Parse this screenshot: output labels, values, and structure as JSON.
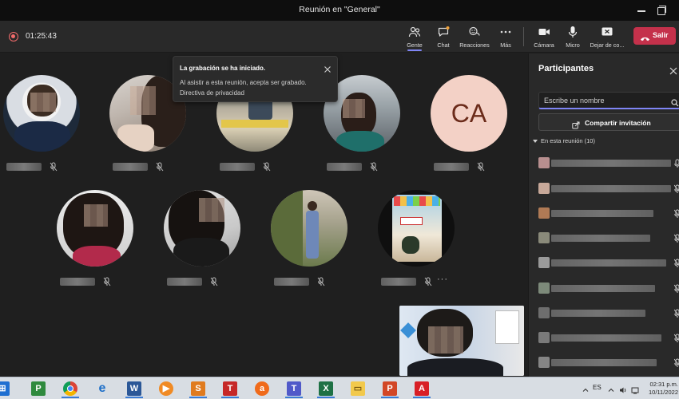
{
  "window": {
    "title": "Reunión en \"General\""
  },
  "toolbar": {
    "timer": "01:25:43",
    "buttons": [
      {
        "label": "Gente",
        "icon": "people-icon"
      },
      {
        "label": "Chat",
        "icon": "chat-icon"
      },
      {
        "label": "Reacciones",
        "icon": "reactions-icon"
      },
      {
        "label": "Más",
        "icon": "more-icon"
      },
      {
        "label": "Cámara",
        "icon": "camera-icon"
      },
      {
        "label": "Micro",
        "icon": "mic-icon"
      },
      {
        "label": "Dejar de co...",
        "icon": "stop-share-icon"
      }
    ],
    "leave_label": "Salir"
  },
  "toast": {
    "title": "La grabación se ha iniciado.",
    "message": "Al asistir a esta reunión, acepta ser grabado.",
    "link": "Directiva de privacidad"
  },
  "participants_tiles": [
    {
      "initials": ""
    },
    {
      "initials": ""
    },
    {
      "initials": ""
    },
    {
      "initials": ""
    },
    {
      "initials": "CA"
    },
    {
      "initials": ""
    },
    {
      "initials": ""
    },
    {
      "initials": ""
    },
    {
      "initials": ""
    }
  ],
  "panel": {
    "title": "Participantes",
    "search_placeholder": "Escribe un nombre",
    "share_label": "Compartir invitación",
    "section_label": "En esta reunión (10)"
  },
  "taskbar": {
    "apps": [
      "windows-icon",
      "powerpoint-viewer-icon",
      "chrome-icon",
      "edge-icon",
      "word-icon",
      "media-player-icon",
      "snagit-icon",
      "tt-app-icon",
      "avast-icon",
      "teams-icon",
      "excel-icon",
      "file-explorer-icon",
      "powerpoint-icon",
      "acrobat-icon"
    ],
    "language": "ES",
    "time": "02:31 p.m.",
    "date": "10/11/2022"
  },
  "colors": {
    "leave": "#c4314b",
    "accent": "#7f85f5",
    "ca_avatar_bg": "#f3d1c6",
    "ca_avatar_text": "#6b2b1a"
  }
}
